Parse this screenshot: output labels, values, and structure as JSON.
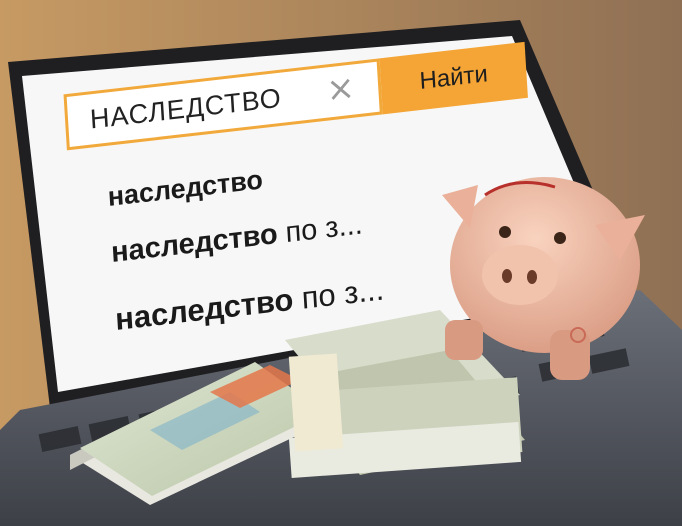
{
  "search": {
    "query": "НАСЛЕДСТВО",
    "clear_glyph": "×",
    "button_label": "Найти"
  },
  "suggestions": [
    {
      "bold": "наследство",
      "rest": ""
    },
    {
      "bold": "наследство",
      "rest": " по з..."
    },
    {
      "bold": "наследство",
      "rest": " по з..."
    }
  ],
  "colors": {
    "accent": "#f4a535",
    "screen_bg": "#fafafa",
    "piggy": "#efb9a2"
  }
}
